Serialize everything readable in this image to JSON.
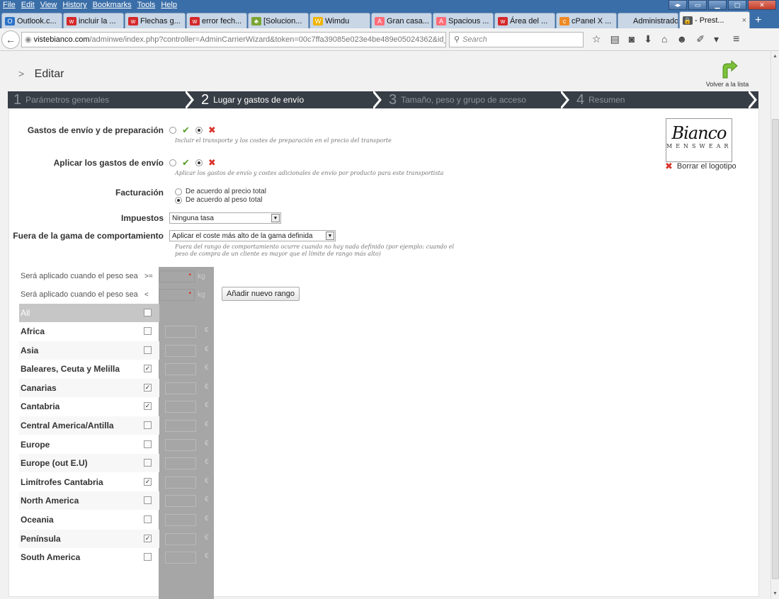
{
  "browser": {
    "menu": [
      "File",
      "Edit",
      "View",
      "History",
      "Bookmarks",
      "Tools",
      "Help"
    ],
    "tabs": [
      {
        "label": "Outlook.c...",
        "icon": "outlook-icon",
        "color": "#2a72c8",
        "glyph": "O"
      },
      {
        "label": "incluir la ...",
        "icon": "wallapop-icon",
        "color": "#d4282a",
        "glyph": "w"
      },
      {
        "label": "Flechas g...",
        "icon": "wallapop-icon",
        "color": "#d4282a",
        "glyph": "w"
      },
      {
        "label": "error fech...",
        "icon": "wallapop-icon",
        "color": "#d4282a",
        "glyph": "w"
      },
      {
        "label": "[Solucion...",
        "icon": "plant-icon",
        "color": "#7aa532",
        "glyph": "♣"
      },
      {
        "label": "Wimdu",
        "icon": "wimdu-icon",
        "color": "#f0b400",
        "glyph": "W"
      },
      {
        "label": "Gran casa...",
        "icon": "airbnb-icon",
        "color": "#ff6c78",
        "glyph": "A"
      },
      {
        "label": "Spacious ...",
        "icon": "airbnb-icon",
        "color": "#ff6c78",
        "glyph": "A"
      },
      {
        "label": "Área del ...",
        "icon": "wallapop-icon",
        "color": "#d4282a",
        "glyph": "w"
      },
      {
        "label": "cPanel X ...",
        "icon": "cpanel-icon",
        "color": "#f08a24",
        "glyph": "c"
      },
      {
        "label": "Administrado...",
        "icon": "blank-icon",
        "color": "#c8d6e6",
        "glyph": ""
      }
    ],
    "active_tab": {
      "label": "- Prest...",
      "close": "×"
    },
    "newtab": "+",
    "url_host": "vistebianco.com",
    "url_path": "/adminwe/index.php?controller=AdminCarrierWizard&token=00c7ffa39085e023e4be489e05024362&id_c",
    "url_ctl": "▽ C",
    "search_placeholder": "Search",
    "nav_icons": [
      "☆",
      "▤",
      "◙",
      "⬇",
      "⌂",
      "☻",
      "✐",
      "▾"
    ],
    "menu_icon": "≡"
  },
  "page": {
    "title": "Editar",
    "title_chevron": ">",
    "back_to_list": "Volver a la lista",
    "steps": [
      {
        "num": "1",
        "label": "Parámetros generales"
      },
      {
        "num": "2",
        "label": "Lugar y gastos de envío"
      },
      {
        "num": "3",
        "label": "Tamaño, peso y grupo de acceso"
      },
      {
        "num": "4",
        "label": "Resumen"
      }
    ],
    "current_step": 2,
    "fields": {
      "shipping_handling_label": "Gastos de envío y de preparación",
      "shipping_handling_help": "Incluir el transporte y los costes de preparación en el precio del transporte",
      "apply_shipping_label": "Aplicar los gastos de envío",
      "apply_shipping_help": "Aplicar los gastos de envío y costes adicionales de envío por producto para este transportista",
      "billing_label": "Facturación",
      "billing_option_1": "De acuerdo al precio total",
      "billing_option_2": "De acuerdo al peso total",
      "tax_label": "Impuestos",
      "tax_value": "Ninguna tasa",
      "out_of_range_label": "Fuera de la gama de comportamiento",
      "out_of_range_value": "Aplicar el coste más alto de la gama definida",
      "out_of_range_help_1": "Fuera del rango de comportamiento ocurre cuando no hay nada definido (por ejemplo: cuando el",
      "out_of_range_help_2": "peso de compra de un cliente es mayor que el límite de rango más alto)"
    },
    "logo": {
      "script": "Bianco",
      "sub": "MENSWEAR",
      "delete": "Borrar el logotipo"
    },
    "ranges": {
      "row1_label": "Será aplicado cuando el peso sea",
      "row1_op": ">=",
      "row2_label": "Será aplicado cuando el peso sea",
      "row2_op": "<",
      "unit": "kg",
      "required": "•",
      "add_button": "Añadir nuevo rango",
      "all_label": "All",
      "currency": "€"
    },
    "zones": [
      {
        "name": "Africa",
        "checked": false
      },
      {
        "name": "Asia",
        "checked": false
      },
      {
        "name": "Baleares, Ceuta y Melilla",
        "checked": true
      },
      {
        "name": "Canarias",
        "checked": true
      },
      {
        "name": "Cantabria",
        "checked": true
      },
      {
        "name": "Central America/Antilla",
        "checked": false
      },
      {
        "name": "Europe",
        "checked": false
      },
      {
        "name": "Europe (out E.U)",
        "checked": false
      },
      {
        "name": "Limítrofes Cantabria",
        "checked": true
      },
      {
        "name": "North America",
        "checked": false
      },
      {
        "name": "Oceania",
        "checked": false
      },
      {
        "name": "Península",
        "checked": true
      },
      {
        "name": "South America",
        "checked": false
      }
    ]
  }
}
